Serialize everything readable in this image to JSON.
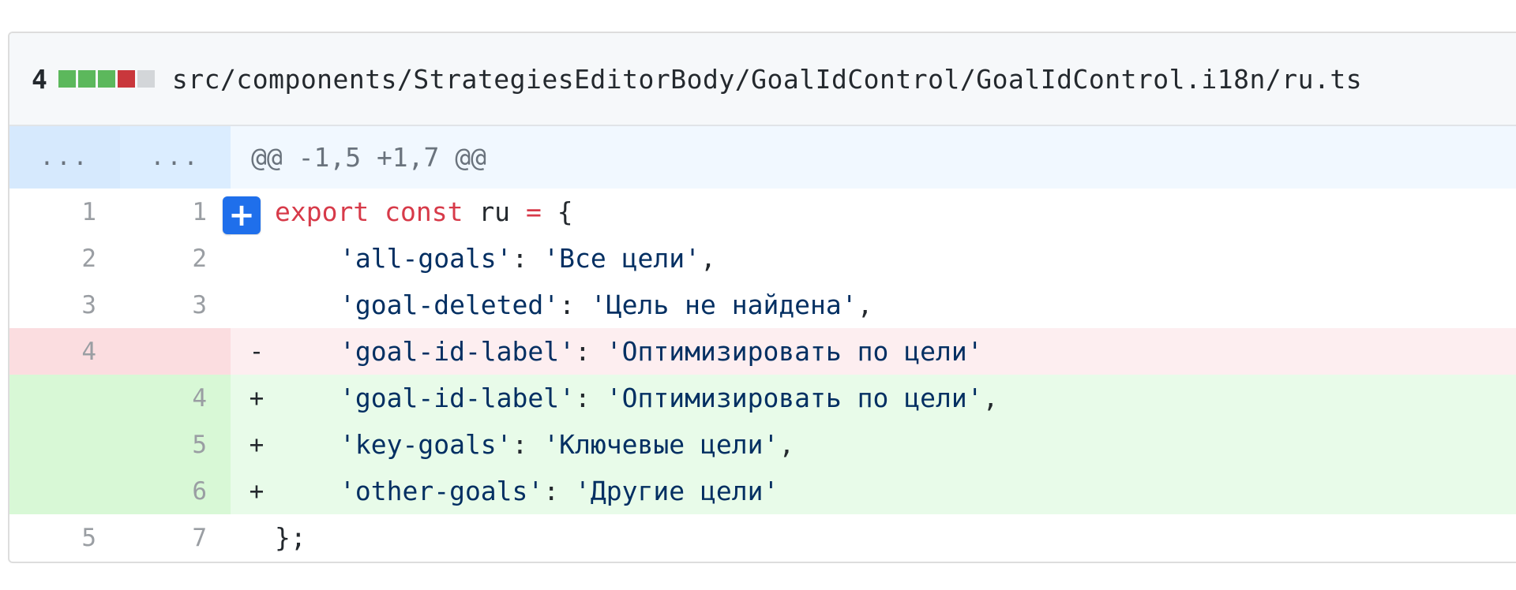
{
  "file": {
    "change_count": "4",
    "path": "src/components/StrategiesEditorBody/GoalIdControl/GoalIdControl.i18n/ru.ts",
    "diffstat": [
      "#5cb85c",
      "#5cb85c",
      "#5cb85c",
      "#c9373c",
      "#d3d6d9"
    ]
  },
  "hunk": {
    "old_dots": "...",
    "new_dots": "...",
    "header": "@@ -1,5 +1,7 @@"
  },
  "add_comment_label": "+",
  "lines": [
    {
      "old": "1",
      "new": "1",
      "marker": "",
      "kw1": "export",
      "kw2": "const",
      "name": "ru",
      "op": "=",
      "brace": "{"
    },
    {
      "old": "2",
      "new": "2",
      "marker": "",
      "key": "'all-goals'",
      "sep": ": ",
      "value": "'Все цели'",
      "tail": ","
    },
    {
      "old": "3",
      "new": "3",
      "marker": "",
      "key": "'goal-deleted'",
      "sep": ": ",
      "value": "'Цель не найдена'",
      "tail": ","
    },
    {
      "old": "4",
      "new": "",
      "marker": "-",
      "key": "'goal-id-label'",
      "sep": ": ",
      "value": "'Оптимизировать по цели'",
      "tail": ""
    },
    {
      "old": "",
      "new": "4",
      "marker": "+",
      "key": "'goal-id-label'",
      "sep": ": ",
      "value": "'Оптимизировать по цели'",
      "tail": ","
    },
    {
      "old": "",
      "new": "5",
      "marker": "+",
      "key": "'key-goals'",
      "sep": ": ",
      "value": "'Ключевые цели'",
      "tail": ","
    },
    {
      "old": "",
      "new": "6",
      "marker": "+",
      "key": "'other-goals'",
      "sep": ": ",
      "value": "'Другие цели'",
      "tail": ""
    },
    {
      "old": "5",
      "new": "7",
      "marker": "",
      "close": "};"
    }
  ]
}
